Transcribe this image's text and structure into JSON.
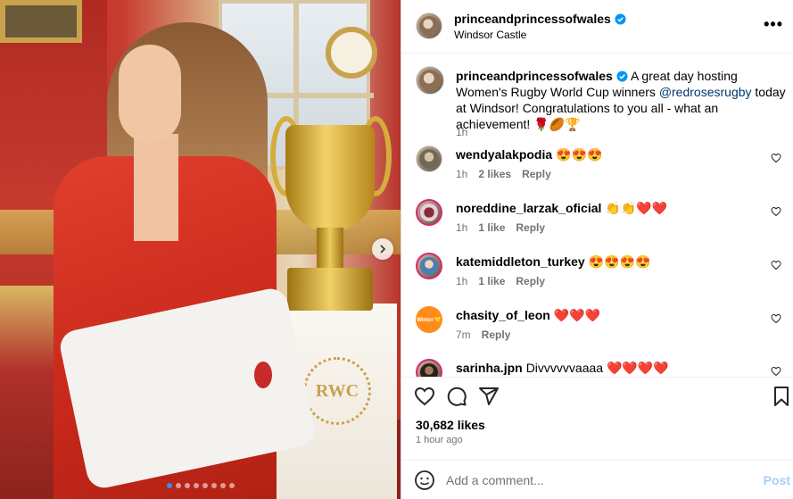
{
  "post": {
    "username": "princeandprincessofwales",
    "location": "Windsor Castle",
    "more_label": "•••",
    "image_alt": "The Princess of Wales holding a signed rugby shirt beside the Rugby World Cup trophy",
    "rwc_logo_text": "RWC",
    "carousel": {
      "count": 8,
      "active_index": 0
    }
  },
  "caption": {
    "username": "princeandprincessofwales",
    "text_before": " A great day hosting Women's Rugby World Cup winners ",
    "mention": "@redrosesrugby",
    "text_after": " today at Windsor! Congratulations to you all - what an achievement! 🌹🏉🏆",
    "time": "1h"
  },
  "comments": [
    {
      "username": "wendyalakpodia",
      "text": "😍😍😍",
      "time": "1h",
      "likes": "2 likes",
      "reply": "Reply",
      "avatar": "wendy"
    },
    {
      "username": "noreddine_larzak_oficial",
      "text": "👏👏❤️❤️",
      "time": "1h",
      "likes": "1 like",
      "reply": "Reply",
      "avatar": "nored"
    },
    {
      "username": "katemiddleton_turkey",
      "text": "😍😍😍😍",
      "time": "1h",
      "likes": "1 like",
      "reply": "Reply",
      "avatar": "kate"
    },
    {
      "username": "chasity_of_leon",
      "text": "❤️❤️❤️",
      "time": "7m",
      "likes": "",
      "reply": "Reply",
      "avatar": "chasity",
      "avatar_text": "Winter 💛"
    },
    {
      "username": "sarinha.jpn",
      "text": "Divvvvvvaaaa ❤️❤️❤️❤️",
      "time": "",
      "likes": "",
      "reply": "",
      "avatar": "sarinha"
    }
  ],
  "stats": {
    "likes": "30,682 likes",
    "posted": "1 hour ago"
  },
  "comment_box": {
    "placeholder": "Add a comment...",
    "post_label": "Post"
  },
  "colors": {
    "link": "#00376b",
    "muted": "#737373",
    "post_disabled": "#a9cdf6",
    "carousel_active": "#3a8cf5",
    "verified": "#0095f6"
  },
  "icons": [
    "verified-badge-icon",
    "more-icon",
    "heart-icon",
    "comment-icon",
    "share-icon",
    "bookmark-icon",
    "emoji-icon",
    "chevron-right-icon"
  ]
}
